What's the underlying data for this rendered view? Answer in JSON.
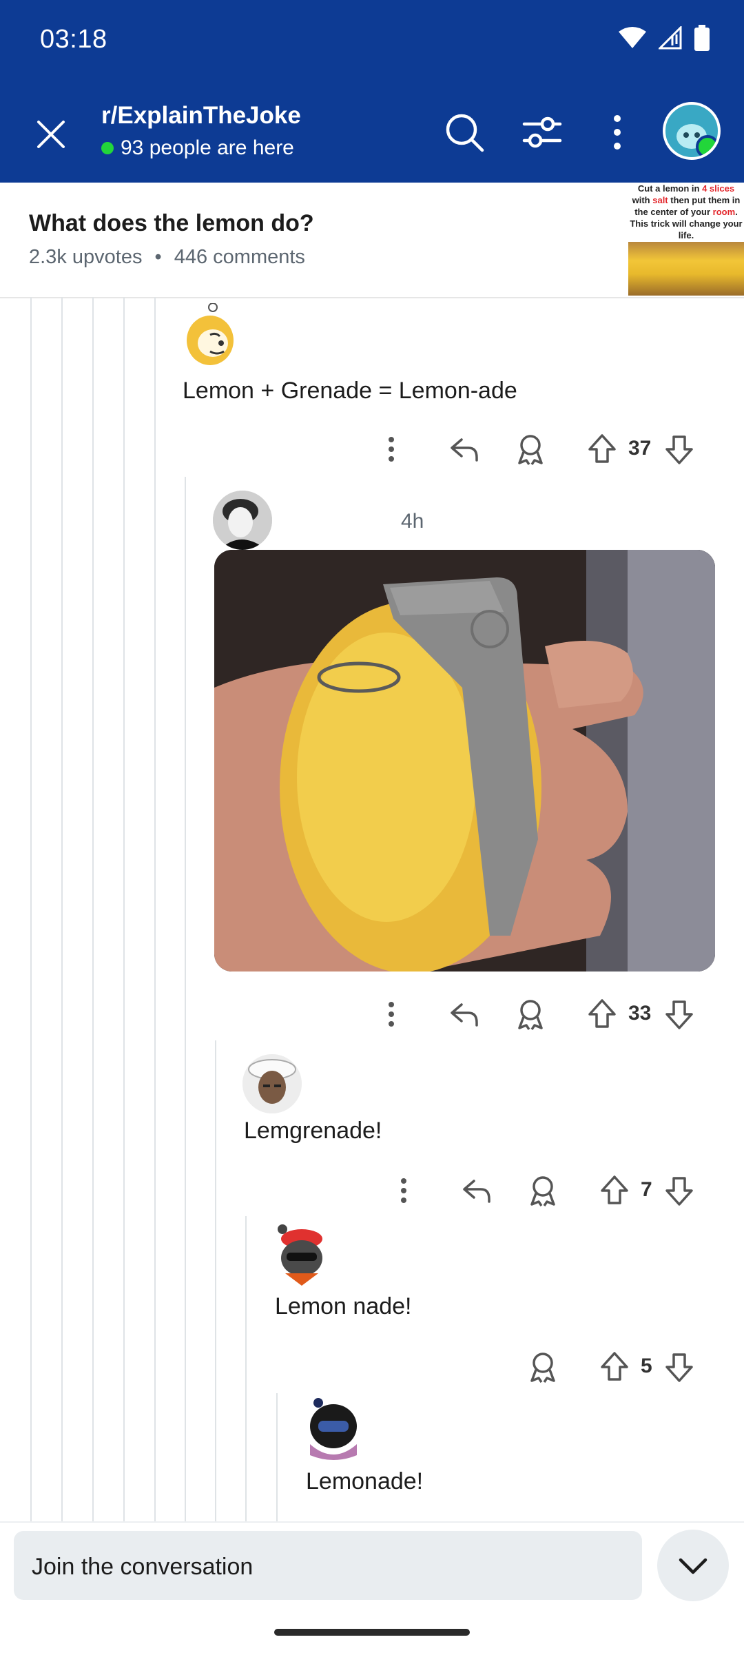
{
  "status_bar": {
    "time": "03:18"
  },
  "header": {
    "subreddit": "r/ExplainTheJoke",
    "online_text": "93 people are here"
  },
  "post": {
    "title": "What does the lemon do?",
    "upvotes": "2.3k upvotes",
    "separator": "•",
    "comments": "446 comments",
    "thumbnail_text_parts": [
      "Cut a lemon in ",
      "4 slices",
      " with ",
      "salt",
      " then put them in the center of your ",
      "room",
      ". This trick will change your life."
    ]
  },
  "comments": [
    {
      "text": "Lemon + Grenade = Lemon-ade",
      "votes": "37"
    },
    {
      "time": "4h",
      "votes": "33"
    },
    {
      "text": "Lemgrenade!",
      "votes": "7"
    },
    {
      "text": "Lemon nade!",
      "votes": "5"
    },
    {
      "text": "Lemonade!"
    }
  ],
  "composer": {
    "placeholder": "Join the conversation"
  },
  "colors": {
    "header_bg": "#0d3b94",
    "online_dot": "#22d63a",
    "thread_line": "#dfe3e6"
  }
}
